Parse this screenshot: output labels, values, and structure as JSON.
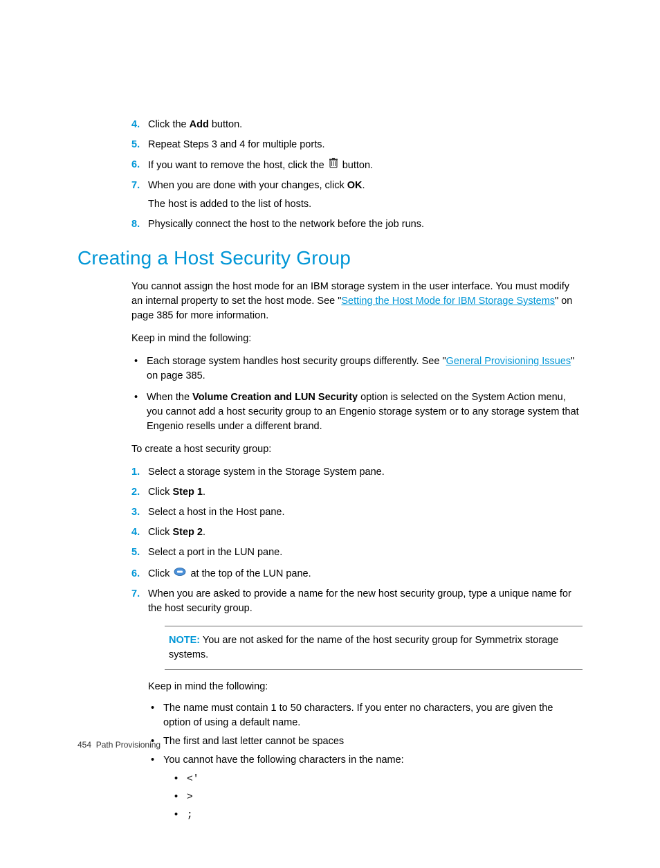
{
  "steps_a": [
    {
      "num": "4.",
      "before": "Click the ",
      "bold": "Add",
      "after": " button."
    },
    {
      "num": "5.",
      "text": "Repeat Steps 3 and 4 for multiple ports."
    },
    {
      "num": "6.",
      "before": "If you want to remove the host, click the ",
      "after": " button.",
      "icon": "trash"
    },
    {
      "num": "7.",
      "before": "When you are done with your changes, click ",
      "bold": "OK",
      "after": ".",
      "subtext": "The host is added to the list of hosts."
    },
    {
      "num": "8.",
      "text": "Physically connect the host to the network before the job runs."
    }
  ],
  "heading": "Creating a Host Security Group",
  "para1_before": "You cannot assign the host mode for an IBM storage system in the user interface. You must modify an internal property to set the host mode. See \"",
  "para1_link": "Setting the Host Mode for IBM Storage Systems",
  "para1_after": "\" on page 385 for more information.",
  "keep_mind": "Keep in mind the following:",
  "bullets1": {
    "b1_before": "Each storage system handles host security groups differently. See \"",
    "b1_link": "General Provisioning Issues",
    "b1_after": "\" on page 385.",
    "b2_before": "When the ",
    "b2_bold": "Volume Creation and LUN Security",
    "b2_after": " option is selected on the System Action menu, you cannot add a host security group to an Engenio storage system or to any storage system that Engenio resells under a different brand."
  },
  "to_create": "To create a host security group:",
  "steps_b": {
    "s1": {
      "num": "1.",
      "text": "Select a storage system in the Storage System pane."
    },
    "s2": {
      "num": "2.",
      "before": "Click ",
      "bold": "Step 1",
      "after": "."
    },
    "s3": {
      "num": "3.",
      "text": "Select a host in the Host pane."
    },
    "s4": {
      "num": "4.",
      "before": "Click ",
      "bold": "Step 2",
      "after": "."
    },
    "s5": {
      "num": "5.",
      "text": "Select a port in the LUN pane."
    },
    "s6": {
      "num": "6.",
      "before": "Click ",
      "after": " at the top of the LUN pane.",
      "icon": "folder"
    },
    "s7": {
      "num": "7.",
      "text": "When you are asked to provide a name for the new host security group, type a unique name for the host security group."
    }
  },
  "note": {
    "label": "NOTE:",
    "text": "   You are not asked for the name of the host security group for Symmetrix storage systems."
  },
  "keep_mind2": "Keep in mind the following:",
  "bullets2": {
    "b1": "The name must contain 1 to 50 characters. If you enter no characters, you are given the option of using a default name.",
    "b2": "The first and last letter cannot be spaces",
    "b3": "You cannot have the following characters in the name:"
  },
  "chars": {
    "c1": "<'",
    "c2": ">",
    "c3": ";"
  },
  "footer": {
    "page": "454",
    "title": "Path Provisioning"
  }
}
